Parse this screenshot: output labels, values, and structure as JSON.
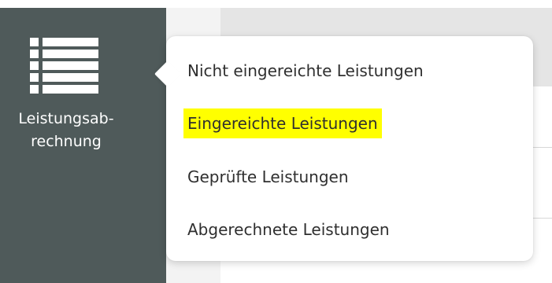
{
  "sidebar": {
    "nav_item": {
      "icon": "list-icon",
      "label": "Leistungsab-\nrechnung"
    }
  },
  "submenu": {
    "items": [
      {
        "label": "Nicht eingereichte Leistungen",
        "highlighted": false
      },
      {
        "label": "Eingereichte Leistungen",
        "highlighted": true
      },
      {
        "label": "Geprüfte Leistungen",
        "highlighted": false
      },
      {
        "label": "Abgerechnete Leistungen",
        "highlighted": false
      }
    ]
  },
  "colors": {
    "sidebar_background": "#4f5a5a",
    "highlight": "#ffff00",
    "menu_text": "#2f2f2f",
    "header_background": "#e5e5e5"
  }
}
